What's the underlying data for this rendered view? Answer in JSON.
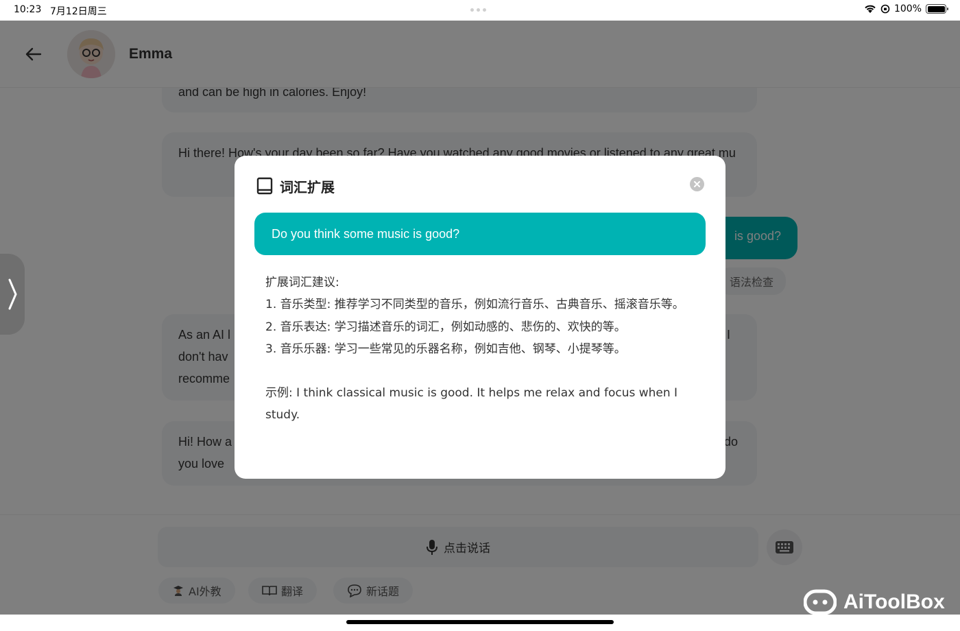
{
  "status_bar": {
    "time": "10:23",
    "date": "7月12日周三",
    "battery": "100%",
    "battery_level": 1.0
  },
  "header": {
    "contact_name": "Emma"
  },
  "chat": {
    "messages": [
      {
        "role": "ai",
        "text": "and can be high in calories. Enjoy!"
      },
      {
        "role": "ai",
        "text": "Hi there! How's your day been so far? Have you watched any good movies or listened to any great mu"
      },
      {
        "role": "user",
        "text": "is good?"
      },
      {
        "role": "ai",
        "text": "As an AI l don't hav recomme"
      },
      {
        "role": "ai",
        "text": "Hi! How a you love "
      }
    ],
    "grammar_check": "语法检查",
    "ai_tail_1": "I",
    "ai_tail_2": "do"
  },
  "footer": {
    "speak_label": "点击说话",
    "chips": [
      {
        "label": "AI外教"
      },
      {
        "label": "翻译"
      },
      {
        "label": "新话题"
      }
    ]
  },
  "modal": {
    "title": "词汇扩展",
    "sentence": "Do you think some music is good?",
    "lines": [
      "扩展词汇建议:",
      "1. 音乐类型: 推荐学习不同类型的音乐，例如流行音乐、古典音乐、摇滚音乐等。",
      "2. 音乐表达: 学习描述音乐的词汇，例如动感的、悲伤的、欢快的等。",
      "3. 音乐乐器: 学习一些常见的乐器名称，例如吉他、钢琴、小提琴等。",
      "示例: I think classical music is good. It helps me relax and focus when I study."
    ]
  },
  "watermark": {
    "text": "AiToolBox"
  },
  "colors": {
    "accent": "#00b3b3",
    "overlay": "rgba(0,0,0,0.5)"
  }
}
